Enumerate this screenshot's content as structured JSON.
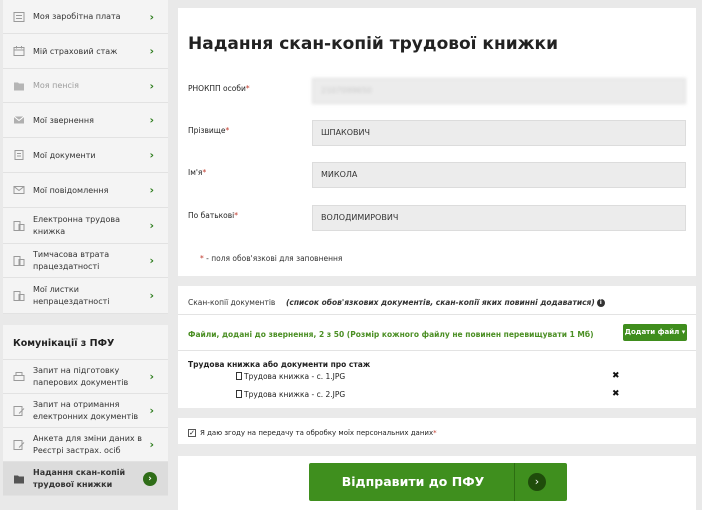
{
  "sidebar": {
    "top_items": [
      {
        "label": "Моя заробітна плата",
        "icon": "salary-icon",
        "disabled": false
      },
      {
        "label": "Мій страховий стаж",
        "icon": "calendar-icon",
        "disabled": false
      },
      {
        "label": "Моя пенсія",
        "icon": "folder-icon",
        "disabled": true
      },
      {
        "label": "Мої звернення",
        "icon": "envelope-icon",
        "disabled": false
      },
      {
        "label": "Мої документи",
        "icon": "document-icon",
        "disabled": false
      },
      {
        "label": "Мої повідомлення",
        "icon": "mail-icon",
        "disabled": false
      },
      {
        "label": "Електронна трудова книжка",
        "icon": "workbook-icon",
        "disabled": false
      },
      {
        "label": "Тимчасова втрата працездатності",
        "icon": "sick-leave-icon",
        "disabled": false
      },
      {
        "label": "Мої листки непрацездатності",
        "icon": "sheets-icon",
        "disabled": false
      }
    ],
    "section_title": "Комунікації з ПФУ",
    "comm_items": [
      {
        "label": "Запит на підготовку паперових документів",
        "icon": "printer-icon"
      },
      {
        "label": "Запит на отримання електронних документів",
        "icon": "edit-doc-icon"
      },
      {
        "label": "Анкета для зміни даних в Реєстрі застрах. осіб",
        "icon": "form-icon"
      },
      {
        "label": "Надання скан-копій трудової книжки",
        "icon": "scan-icon",
        "active": true
      }
    ],
    "arrow": "›"
  },
  "main": {
    "title": "Надання скан-копій трудової книжки",
    "fields": [
      {
        "label": "РНОКПП особи",
        "value": "2107099650",
        "blurred": true
      },
      {
        "label": "Прізвище",
        "value": "ШПАКОВИЧ",
        "blurred": false
      },
      {
        "label": "Ім'я",
        "value": "МИКОЛА",
        "blurred": false
      },
      {
        "label": "По батькові",
        "value": "ВОЛОДИМИРОВИЧ",
        "blurred": false
      }
    ],
    "required_mark": "*",
    "required_note": "- поля обов'язкові для заповнення",
    "scan_label": "Скан-копії документів",
    "scan_note": "(список обов'язкових документів, скан-копії яких повинні додаватися)",
    "files_info": "Файли, додані до звернення, 2 з 50 (Розмір кожного файлу не повинен перевищувати 1 Мб)",
    "add_file_label": "Додати файл ▾",
    "section_title": "Трудова книжка або документи про стаж",
    "files": [
      "Трудова книжка - с. 1.JPG",
      "Трудова книжка - с. 2.JPG"
    ],
    "delete_icon": "✖",
    "consent_text": "Я даю згоду на передачу та обробку моїх персональних даних",
    "consent_checked": true,
    "submit_label": "Відправити до ПФУ",
    "submit_arrow": "›"
  },
  "colors": {
    "accent": "#3f8f1e",
    "dark_accent": "#1f4c0b",
    "required": "#c0392b",
    "info_green": "#4b8f24"
  }
}
